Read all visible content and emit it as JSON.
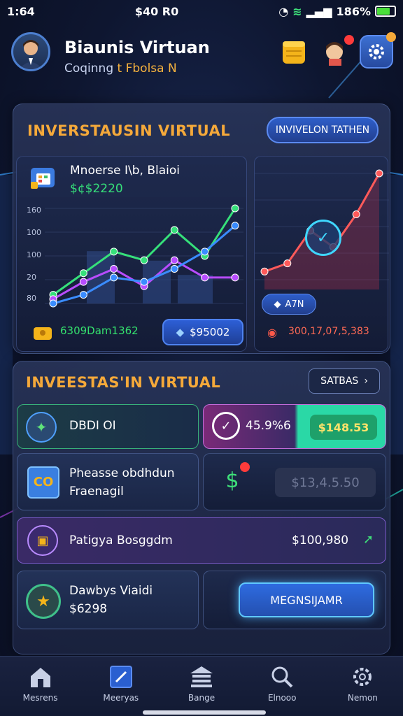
{
  "status_bar": {
    "time": "1:64",
    "center": "$40 R0",
    "battery": "186%"
  },
  "header": {
    "title": "Biaunis Virtuan",
    "subtitle_prefix": "Coqinng",
    "subtitle_highlight": "t Fbolsa N"
  },
  "invest_card": {
    "title": "INVERSTAUSIN VIRTUAL",
    "action_label": "INVIVELON TATHEN",
    "left_chart": {
      "name": "Mnoerse I\\b, Blaioi",
      "value": "$¢$2220",
      "y_labels": [
        "160",
        "100",
        "100",
        "20",
        "80"
      ],
      "footer_label": "6309Dam1362",
      "footer_value": "$95002"
    },
    "right_chart": {
      "badge": "A7N",
      "footer": "300,17,07,5,383"
    }
  },
  "chart_data": [
    {
      "type": "line",
      "title": "Mnoerse I\\b, Blaioi",
      "series": [
        {
          "values": [
            10,
            35,
            60,
            50,
            85,
            55,
            110
          ]
        },
        {
          "values": [
            5,
            25,
            40,
            20,
            50,
            30,
            30
          ]
        },
        {
          "values": [
            0,
            10,
            30,
            25,
            40,
            60,
            90
          ]
        }
      ]
    },
    {
      "type": "line",
      "series": [
        {
          "values": [
            10,
            20,
            60,
            40,
            80,
            130
          ]
        }
      ]
    }
  ],
  "invest_section": {
    "title": "INVEESTAS'IN VIRTUAL",
    "action_label": "SATBAS",
    "rows": [
      {
        "left_label": "DBDI OI",
        "right_pct": "45.9%6",
        "right_value": "$148.53"
      },
      {
        "left_line1": "Pheasse obdhdun",
        "left_line2": "Fraenagil",
        "right_value": "$13,4.5.50"
      },
      {
        "label": "Patigya Bosggdm",
        "value": "$100,980"
      },
      {
        "line1": "Dawbys Viaidi",
        "line2": "$6298",
        "button": "MEGNSIJAMR"
      }
    ]
  },
  "bottom_nav": [
    {
      "label": "Mesrens",
      "icon": "home-icon"
    },
    {
      "label": "Meeryas",
      "icon": "chart-icon"
    },
    {
      "label": "Bange",
      "icon": "bank-icon"
    },
    {
      "label": "Elnooo",
      "icon": "search-icon"
    },
    {
      "label": "Nemon",
      "icon": "settings-icon"
    }
  ]
}
